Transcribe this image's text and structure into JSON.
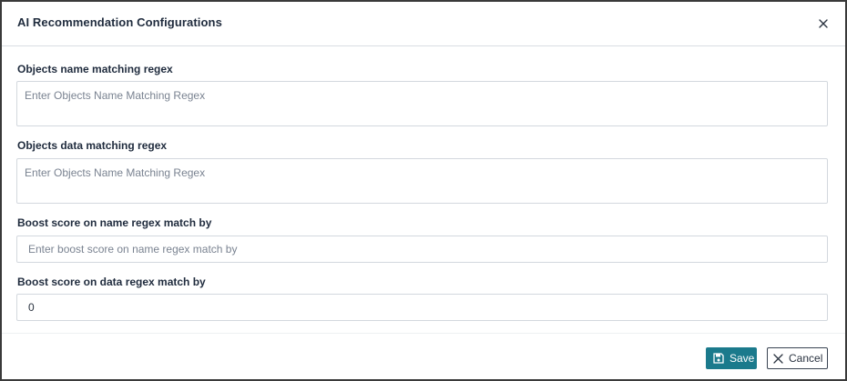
{
  "dialog": {
    "title": "AI Recommendation Configurations",
    "close_icon": "close-icon"
  },
  "fields": {
    "name_regex": {
      "label": "Objects name matching regex",
      "placeholder": "Enter Objects Name Matching Regex",
      "value": ""
    },
    "data_regex": {
      "label": "Objects data matching regex",
      "placeholder": "Enter Objects Name Matching Regex",
      "value": ""
    },
    "name_boost": {
      "label": "Boost score on name regex match by",
      "placeholder": "Enter boost score on name regex match by",
      "value": ""
    },
    "data_boost": {
      "label": "Boost score on data regex match by",
      "placeholder": "",
      "value": "0"
    }
  },
  "footer": {
    "save_label": "Save",
    "save_icon": "floppy-disk-icon",
    "cancel_label": "Cancel",
    "cancel_icon": "close-icon"
  },
  "colors": {
    "primary": "#1b7a8c",
    "border": "#d3d8de",
    "text": "#1f2b3d",
    "placeholder": "#7a8391"
  }
}
